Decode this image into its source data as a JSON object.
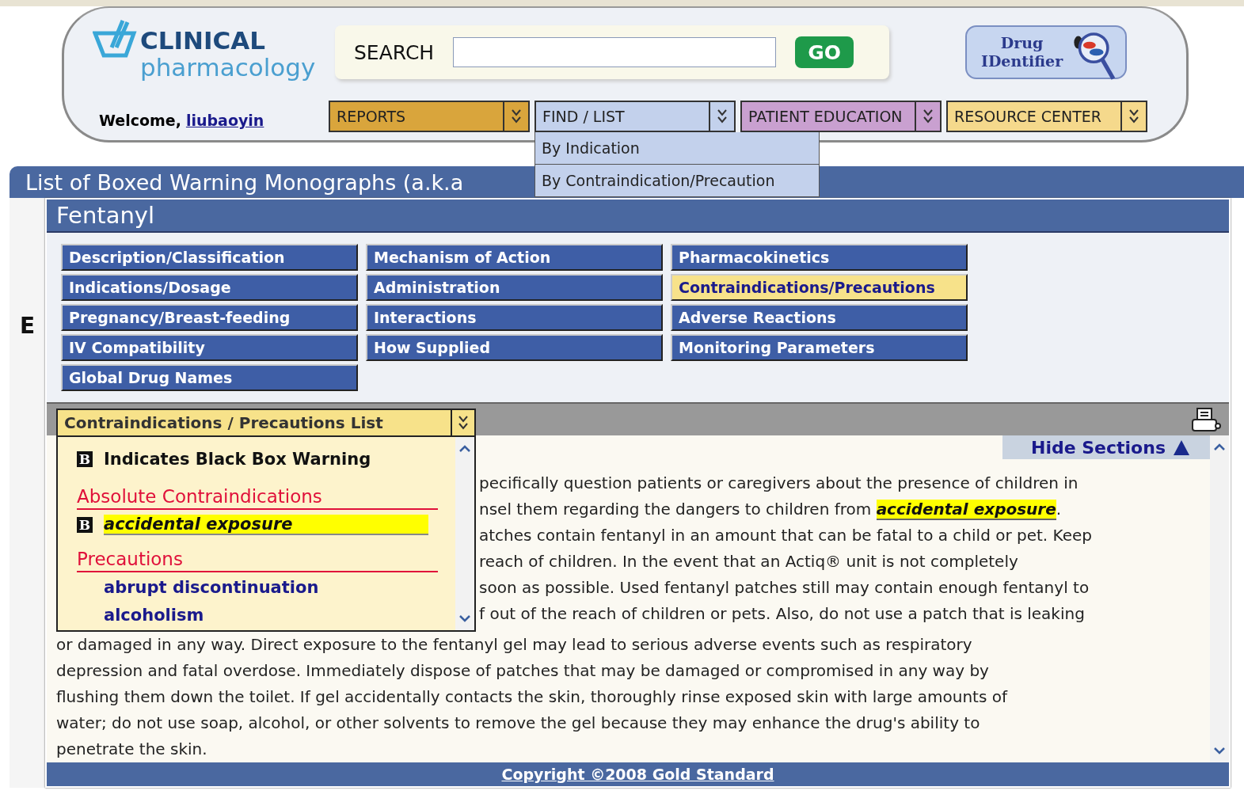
{
  "header": {
    "logo": {
      "title": "CLINICAL",
      "subtitle": "pharmacology"
    },
    "welcome": {
      "text": "Welcome,",
      "user": "liubaoyin"
    },
    "search": {
      "label": "SEARCH",
      "button": "GO"
    },
    "drug_identifier": {
      "line1": "Drug",
      "line2": "IDentifier"
    }
  },
  "nav": [
    {
      "label": "REPORTS",
      "color": "#d9a53c"
    },
    {
      "label": "FIND / LIST",
      "color": "#c3d1ec",
      "menu": [
        "By Indication",
        "By Contraindication/Precaution"
      ]
    },
    {
      "label": "PATIENT EDUCATION",
      "color": "#c9a0d0"
    },
    {
      "label": "RESOURCE CENTER",
      "color": "#f5d98c"
    }
  ],
  "background_page": {
    "title": "List of Boxed Warning Monographs (a.k.a",
    "heading_fragment": "E"
  },
  "monograph": {
    "title": "Fentanyl",
    "sections": [
      {
        "label": "Description/Classification",
        "selected": false
      },
      {
        "label": "Mechanism of Action",
        "selected": false
      },
      {
        "label": "Pharmacokinetics",
        "selected": false
      },
      {
        "label": "Indications/Dosage",
        "selected": false
      },
      {
        "label": "Administration",
        "selected": false
      },
      {
        "label": "Contraindications/Precautions",
        "selected": true
      },
      {
        "label": "Pregnancy/Breast-feeding",
        "selected": false
      },
      {
        "label": "Interactions",
        "selected": false
      },
      {
        "label": "Adverse Reactions",
        "selected": false
      },
      {
        "label": "IV Compatibility",
        "selected": false
      },
      {
        "label": "How Supplied",
        "selected": false
      },
      {
        "label": "Monitoring Parameters",
        "selected": false
      },
      {
        "label": "Global Drug Names",
        "selected": false
      }
    ],
    "list_dropdown": {
      "title": "Contraindications / Precautions List",
      "legend": {
        "badge": "B",
        "text": "Indicates Black Box Warning"
      },
      "groups": [
        {
          "heading": "Absolute Contraindications",
          "items": [
            {
              "badge": "B",
              "label": "accidental exposure",
              "selected": true
            }
          ]
        },
        {
          "heading": "Precautions",
          "items": [
            {
              "label": "abrupt discontinuation",
              "selected": false
            },
            {
              "label": "alcoholism",
              "selected": false
            }
          ]
        }
      ]
    },
    "hide_sections": "Hide Sections",
    "partial_lines": [
      [
        {
          "text": "pecifically question patients or caregivers about the presence of children in",
          "highlighted": false
        }
      ],
      [
        {
          "text": "nsel them regarding the dangers to children from ",
          "highlighted": false
        },
        {
          "text": "accidental exposure",
          "highlighted": true
        },
        {
          "text": ".",
          "highlighted": false
        }
      ],
      [
        {
          "text": "atches contain fentanyl in an amount that can be fatal to a child or pet. Keep",
          "highlighted": false
        }
      ],
      [
        {
          "text": "reach of children. In the event that an Actiq® unit is not completely",
          "highlighted": false
        }
      ],
      [
        {
          "text": "soon as possible. Used fentanyl patches still may contain enough fentanyl to",
          "highlighted": false
        }
      ],
      [
        {
          "text": "f out of the reach of children or pets. Also, do not use a patch that is leaking",
          "highlighted": false
        }
      ]
    ],
    "lines": [
      "or damaged in any way. Direct exposure to the fentanyl gel may lead to serious adverse events such as respiratory",
      "depression and fatal overdose. Immediately dispose of patches that may be damaged or compromised in any way by",
      "flushing them down the toilet. If gel accidentally contacts the skin, thoroughly rinse exposed skin with large amounts of",
      "water; do not use soap, alcohol, or other solvents to remove the gel because they may enhance the drug's ability to",
      "penetrate the skin."
    ],
    "footer": "Copyright ©2008 Gold Standard"
  }
}
